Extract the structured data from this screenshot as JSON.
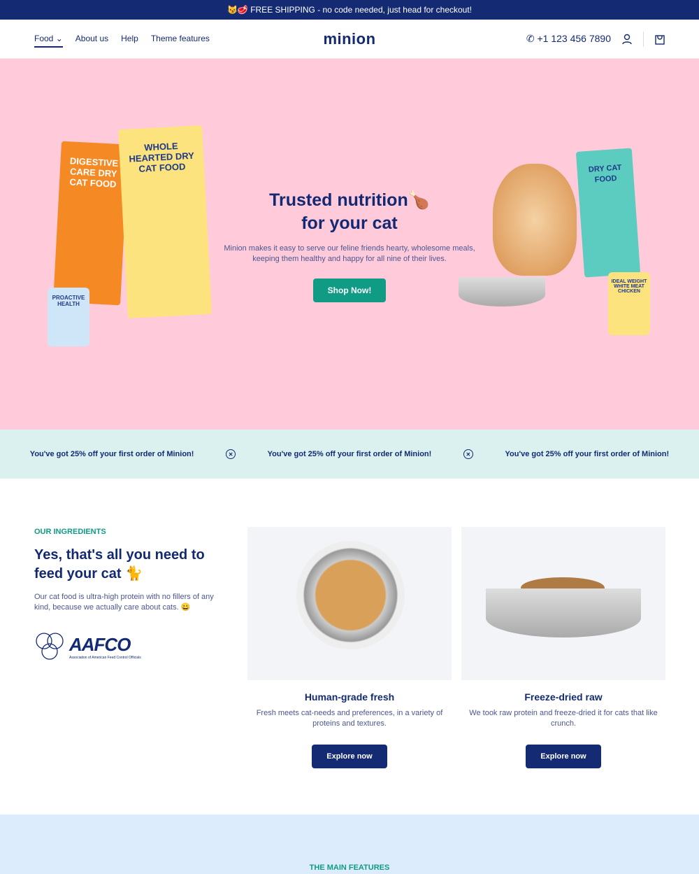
{
  "announcement": {
    "emoji": "😼🥩",
    "text": "FREE SHIPPING - no code needed, just head for checkout!"
  },
  "header": {
    "nav": [
      {
        "label": "Food"
      },
      {
        "label": "About us"
      },
      {
        "label": "Help"
      },
      {
        "label": "Theme features"
      }
    ],
    "logo": "minion",
    "phone": "+1 123 456 7890"
  },
  "hero": {
    "title_line1": "Trusted nutrition",
    "title_emoji": "🍗",
    "title_line2": "for your cat",
    "subtitle": "Minion makes it easy to serve our feline friends hearty, wholesome meals, keeping them healthy and happy for all nine of their lives.",
    "cta": "Shop Now!",
    "products": {
      "bag1": "DIGESTIVE CARE DRY CAT FOOD",
      "bag2": "WHOLE HEARTED DRY CAT FOOD",
      "bag3": "DRY CAT FOOD",
      "can1": "PROACTIVE HEALTH",
      "can2": "IDEAL WEIGHT WHITE MEAT CHICKEN"
    }
  },
  "promo": {
    "text": "You've got 25% off your first order of Minion!"
  },
  "ingredients": {
    "eyebrow": "OUR INGREDIENTS",
    "title": "Yes, that's all you need to feed your cat",
    "title_emoji": "🐈",
    "text": "Our cat food is ultra-high protein with no fillers of any kind, because we actually care about cats. 😀",
    "logo_name": "AAFCO",
    "logo_caption": "Association of American Feed Control Officials",
    "cards": [
      {
        "title": "Human-grade fresh",
        "text": "Fresh meets cat-needs and preferences, in a variety of proteins and textures.",
        "cta": "Explore now"
      },
      {
        "title": "Freeze-dried raw",
        "text": "We took raw protein and freeze-dried it for cats that like crunch.",
        "cta": "Explore now"
      }
    ]
  },
  "features": {
    "eyebrow": "THE MAIN FEATURES"
  },
  "colors": {
    "navy": "#142b73",
    "teal": "#109b85",
    "pink": "#ffcbdb",
    "mint": "#dbf1ef",
    "lightblue": "#dcecfd"
  }
}
